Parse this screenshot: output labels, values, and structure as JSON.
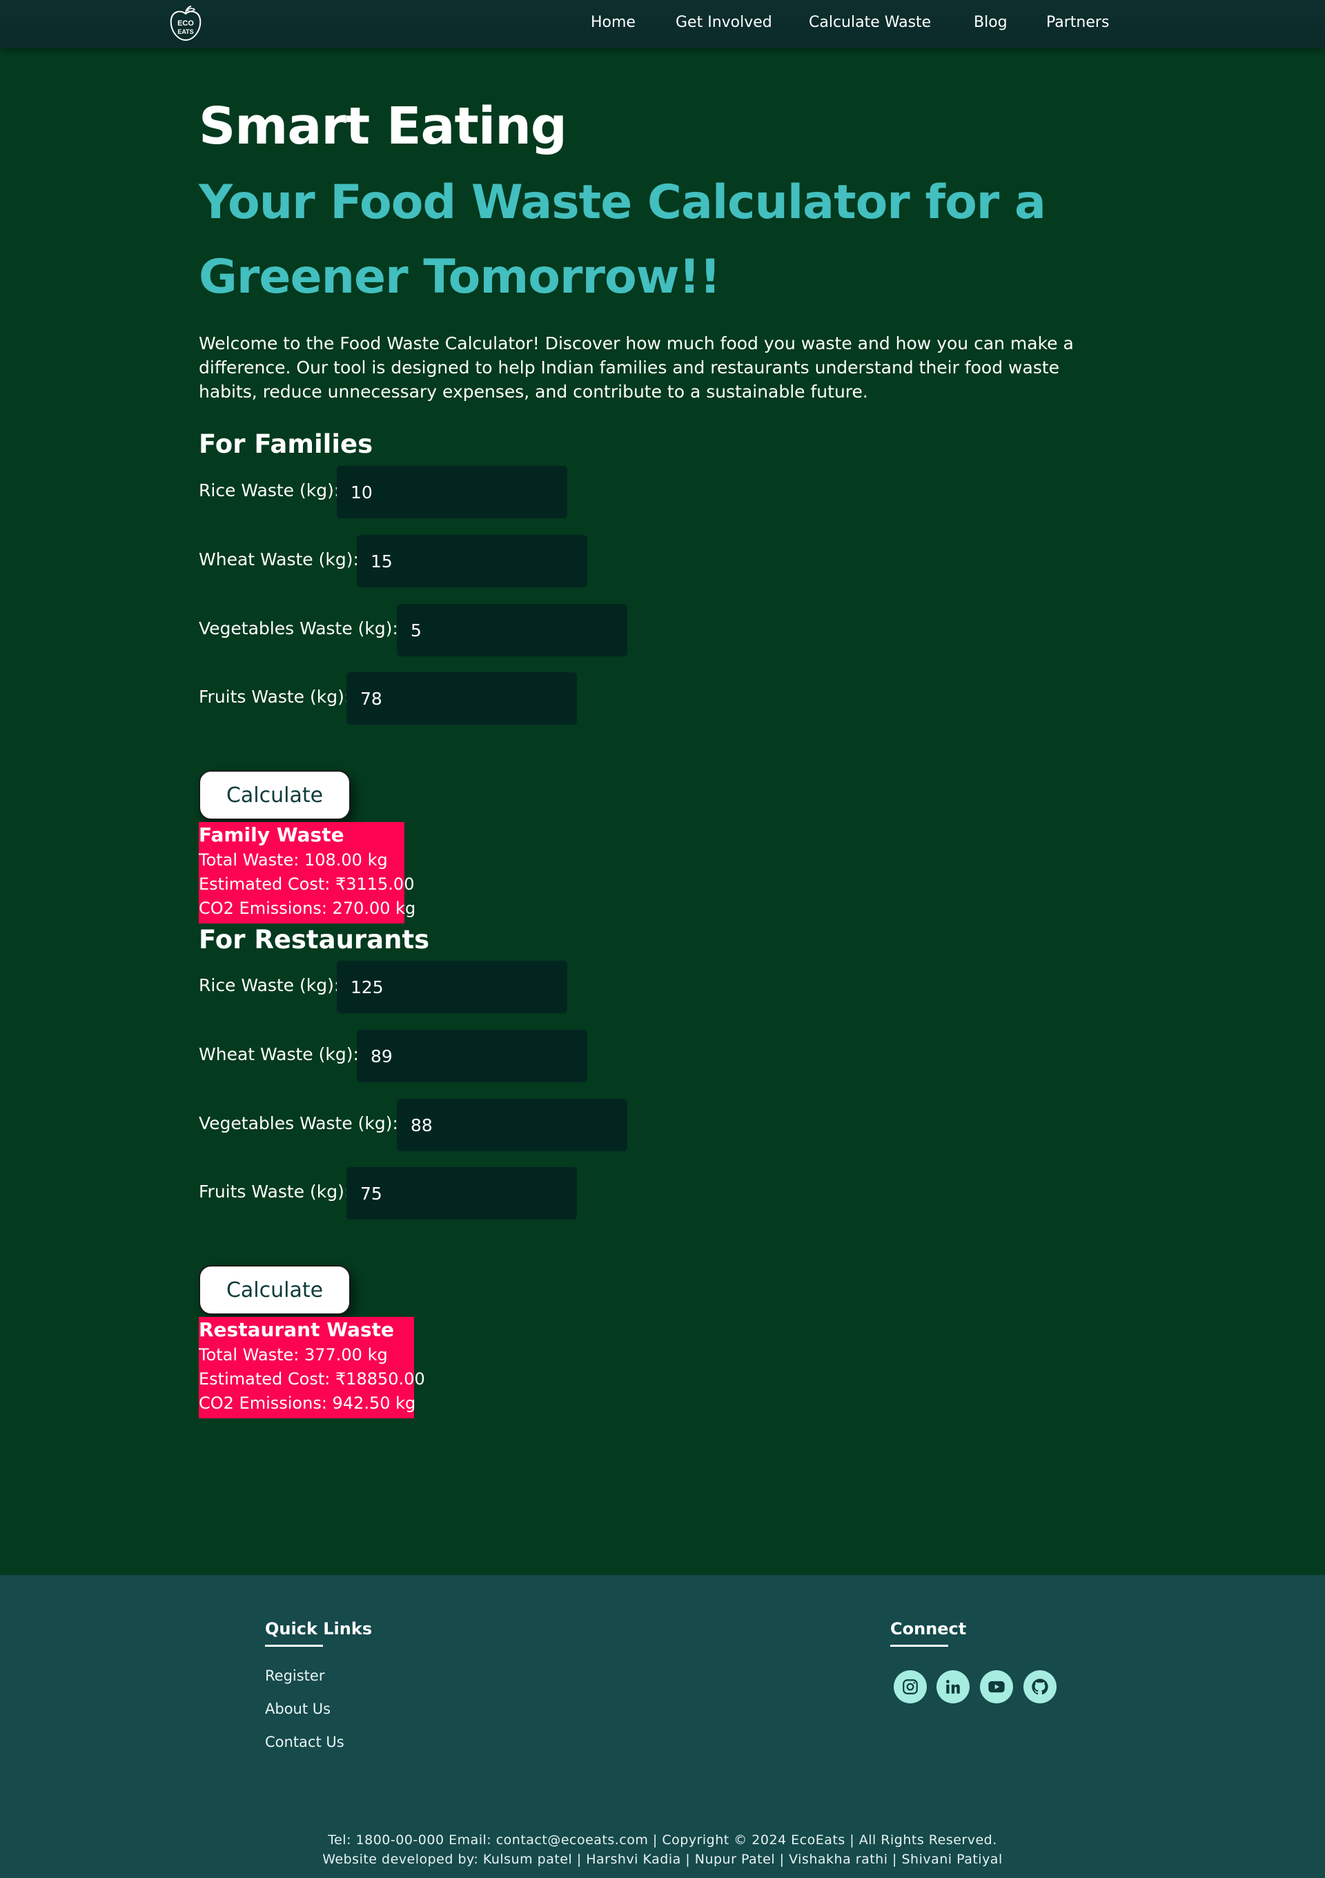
{
  "nav": {
    "logo_text_top": "ECO",
    "logo_text_bottom": "EATS",
    "links": [
      "Home",
      "Get Involved",
      "Calculate Waste",
      "Blog",
      "Partners"
    ]
  },
  "hero": {
    "title": "Smart Eating",
    "subtitle": "Your Food Waste Calculator for a Greener Tomorrow!!",
    "intro": "Welcome to the Food Waste Calculator! Discover how much food you waste and how you can make a difference. Our tool is designed to help Indian families and restaurants understand their food waste habits, reduce unnecessary expenses, and contribute to a sustainable future."
  },
  "families": {
    "heading": "For Families",
    "fields": [
      {
        "label": "Rice Waste (kg):",
        "value": "10"
      },
      {
        "label": "Wheat Waste (kg):",
        "value": "15"
      },
      {
        "label": "Vegetables Waste (kg):",
        "value": "5"
      },
      {
        "label": "Fruits Waste (kg):",
        "value": "78"
      }
    ],
    "button": "Calculate",
    "result": {
      "title": "Family Waste",
      "total": "Total Waste: 108.00 kg",
      "cost": "Estimated Cost: ₹3115.00",
      "co2": "CO2 Emissions: 270.00 kg"
    }
  },
  "restaurants": {
    "heading": "For Restaurants",
    "fields": [
      {
        "label": "Rice Waste (kg):",
        "value": "125"
      },
      {
        "label": "Wheat Waste (kg):",
        "value": "89"
      },
      {
        "label": "Vegetables Waste (kg):",
        "value": "88"
      },
      {
        "label": "Fruits Waste (kg):",
        "value": "75"
      }
    ],
    "button": "Calculate",
    "result": {
      "title": "Restaurant Waste",
      "total": "Total Waste: 377.00 kg",
      "cost": "Estimated Cost: ₹18850.00",
      "co2": "CO2 Emissions: 942.50 kg"
    }
  },
  "footer": {
    "quick_links_heading": "Quick Links",
    "quick_links": [
      "Register",
      "About Us",
      "Contact Us"
    ],
    "connect_heading": "Connect",
    "social_icons": [
      "instagram-icon",
      "linkedin-icon",
      "youtube-icon",
      "github-icon"
    ],
    "contact_line": "Tel: 1800-00-000 Email: contact@ecoeats.com | Copyright © 2024 EcoEats | All Rights Reserved.",
    "credits_line": "Website developed by: Kulsum patel | Harshvi Kadia | Nupur Patel | Vishakha rathi | Shivani Patiyal"
  },
  "colors": {
    "page_bg": "#043a1e",
    "accent_teal": "#43bfbf",
    "result_bg": "#fc0451",
    "input_bg": "#032520",
    "footer_bg": "#164a4b",
    "social_icon_bg": "#a6ece1"
  }
}
